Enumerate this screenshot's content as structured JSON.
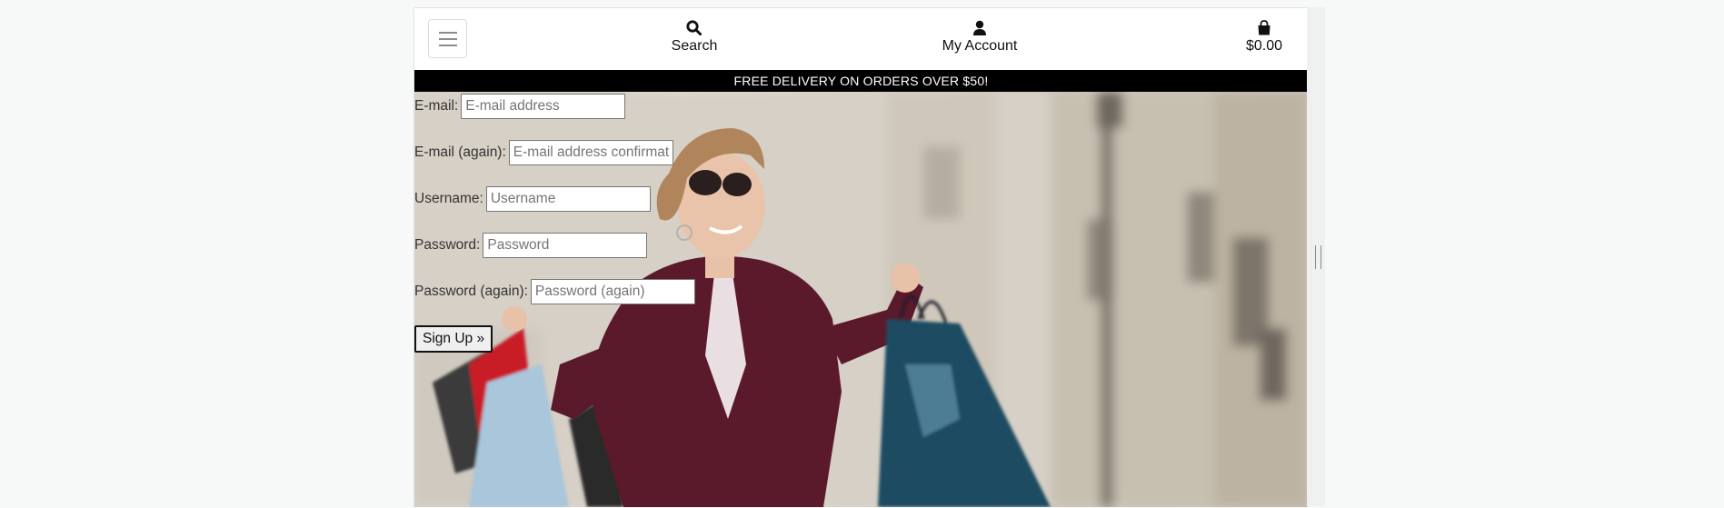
{
  "header": {
    "menu_icon": "hamburger-menu-icon",
    "search": {
      "icon": "search-icon",
      "label": "Search"
    },
    "account": {
      "icon": "user-icon",
      "label": "My Account"
    },
    "bag": {
      "icon": "shopping-bag-icon",
      "label": "$0.00"
    }
  },
  "banner": {
    "text": "FREE DELIVERY ON ORDERS OVER $50!"
  },
  "form": {
    "fields": [
      {
        "label": "E-mail:",
        "placeholder": "E-mail address",
        "value": ""
      },
      {
        "label": "E-mail (again):",
        "placeholder": "E-mail address confirmation",
        "value": ""
      },
      {
        "label": "Username:",
        "placeholder": "Username",
        "value": ""
      },
      {
        "label": "Password:",
        "placeholder": "Password",
        "value": ""
      },
      {
        "label": "Password (again):",
        "placeholder": "Password (again)",
        "value": ""
      }
    ],
    "submit_label": "Sign Up »"
  },
  "colors": {
    "banner_bg": "#000000",
    "banner_text": "#ffffff",
    "page_bg": "#f7f9f8"
  }
}
